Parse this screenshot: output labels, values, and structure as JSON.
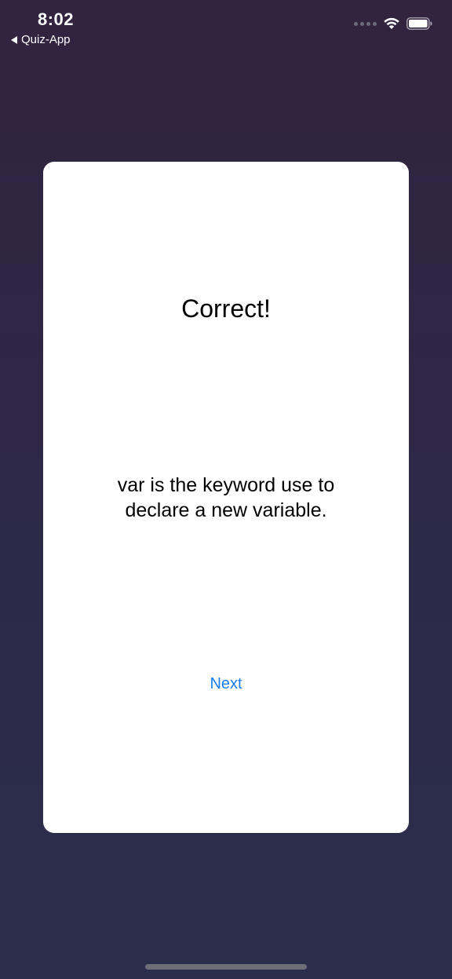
{
  "status_bar": {
    "time": "8:02",
    "back_app_label": "Quiz-App",
    "icons": [
      "back-arrow-icon",
      "signal-icon",
      "wifi-icon",
      "battery-icon"
    ]
  },
  "card": {
    "title": "Correct!",
    "explanation": "var is the keyword use to declare a new variable.",
    "next_label": "Next"
  },
  "colors": {
    "background_top": "#32233f",
    "background_bottom": "#2a2f4b",
    "card": "#ffffff",
    "link": "#1a7cf0"
  }
}
